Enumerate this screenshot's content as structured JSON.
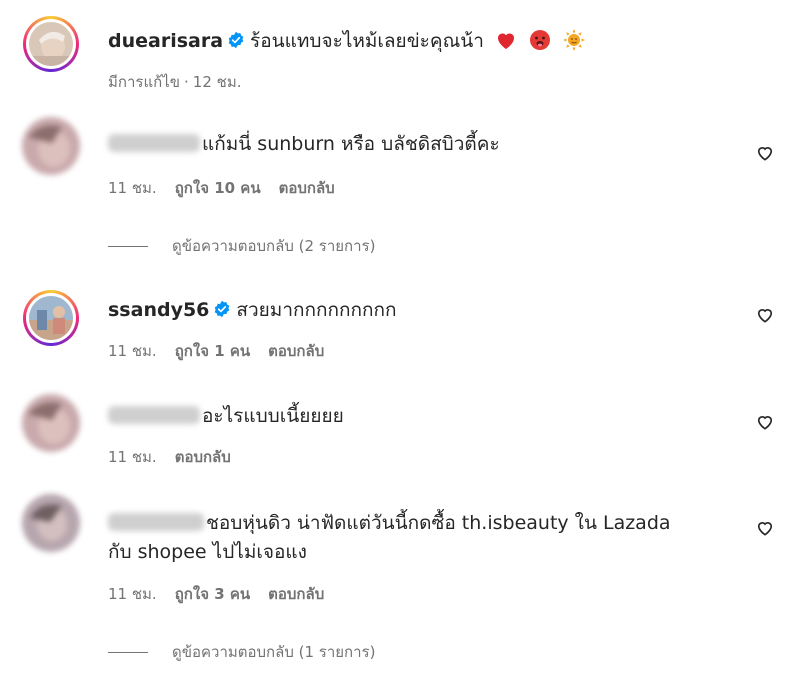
{
  "comments": [
    {
      "username": "duearisara",
      "verified": true,
      "text": "ร้อนแทบจะไหม้เลยข่ะคุณน้า",
      "emojis": [
        "heart-emoji",
        "hot-face-emoji",
        "sun-emoji"
      ],
      "meta": {
        "edited": "มีการแก้ไข",
        "time": "12 ชม."
      }
    },
    {
      "username_blurred": true,
      "text": "แก้มนี่ sunburn หรือ บลัชดิสบิวตี้คะ",
      "meta": {
        "time": "11 ชม.",
        "likes": "ถูกใจ 10 คน",
        "reply": "ตอบกลับ"
      },
      "view_replies": "ดูข้อความตอบกลับ (2 รายการ)"
    },
    {
      "username": "ssandy56",
      "verified": true,
      "text": "สวยมากกกกกกกกก",
      "meta": {
        "time": "11 ชม.",
        "likes": "ถูกใจ 1 คน",
        "reply": "ตอบกลับ"
      }
    },
    {
      "username_blurred": true,
      "text": "อะไรแบบเนี้ยยยย",
      "meta": {
        "time": "11 ชม.",
        "reply": "ตอบกลับ"
      }
    },
    {
      "username_blurred": true,
      "text_line1": "ชอบหุ่นดิว น่าฟัดแต่วันนี้กดซื้อ th.isbeauty ใน Lazada",
      "text_line2": "กับ shopee ไปไม่เจอแง",
      "meta": {
        "time": "11 ชม.",
        "likes": "ถูกใจ 3 คน",
        "reply": "ตอบกลับ"
      },
      "view_replies": "ดูข้อความตอบกลับ (1 รายการ)"
    }
  ],
  "colors": {
    "text": "#262626",
    "secondary": "#737373",
    "verified": "#0095f6"
  }
}
